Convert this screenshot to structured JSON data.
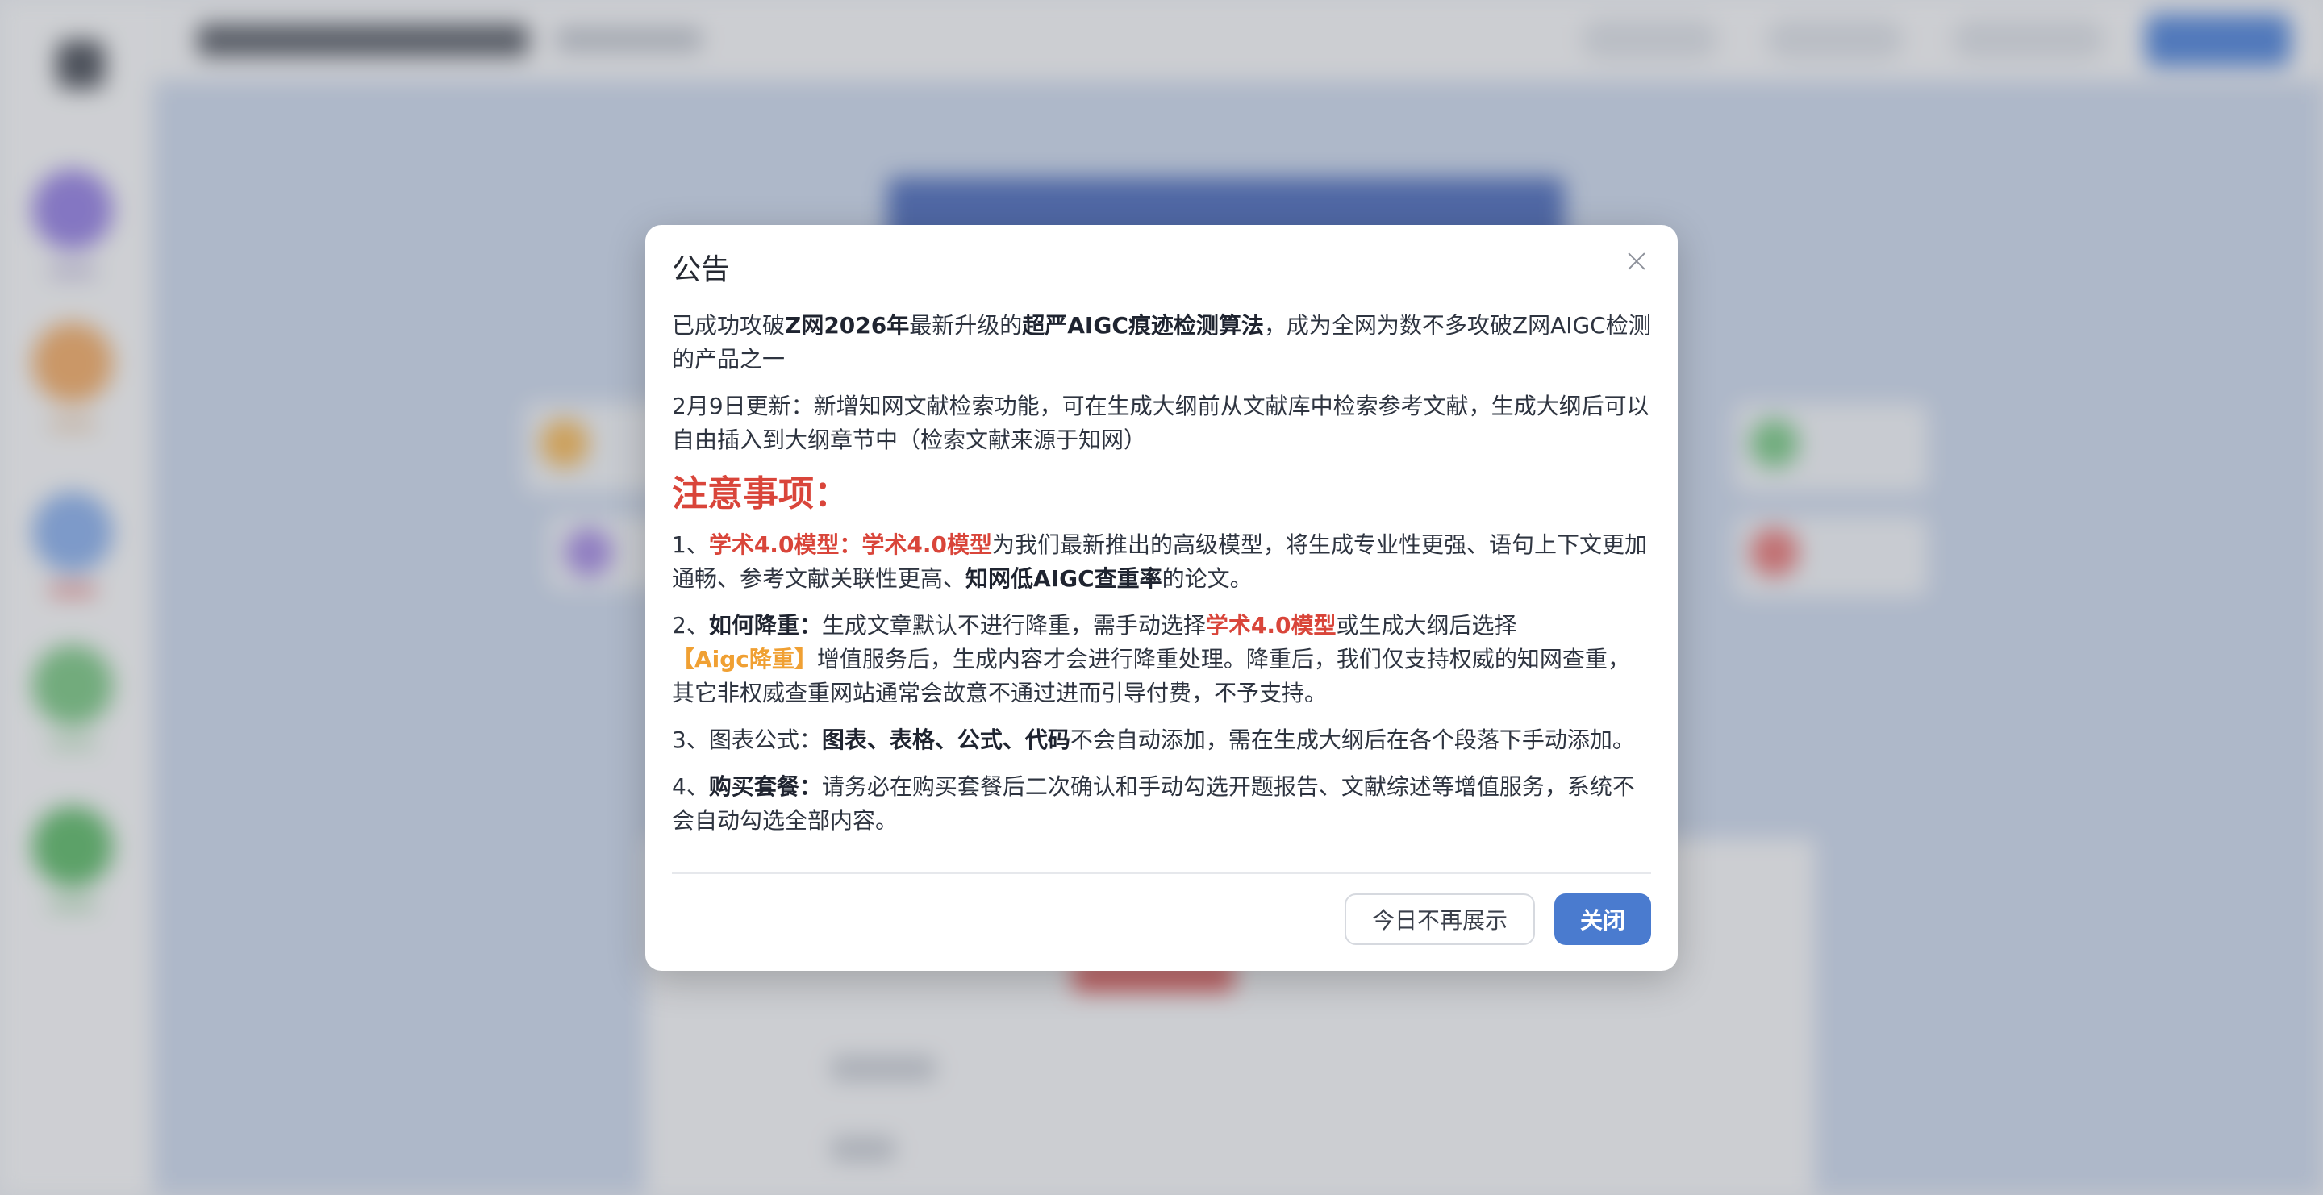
{
  "dialog": {
    "title": "公告",
    "intro": {
      "p1": "已成功攻破",
      "b1": "Z网2026年",
      "p2": "最新升级的",
      "b2": "超严AIGC痕迹检测算法",
      "p3": "，成为全网为数不多攻破Z网AIGC检测的产品之一"
    },
    "update": "2月9日更新：新增知网文献检索功能，可在生成大纲前从文献库中检索参考文献，生成大纲后可以自由插入到大纲章节中（检索文献来源于知网）",
    "notice_heading": "注意事项：",
    "item1": {
      "prefix": "1、",
      "red": "学术4.0模型：学术4.0模型",
      "p1": "为我们最新推出的高级模型，将生成专业性更强、语句上下文更加通畅、参考文献关联性更高、",
      "b1": "知网低AIGC查重率",
      "p2": "的论文。"
    },
    "item2": {
      "prefix": "2、",
      "b1": "如何降重：",
      "p1": "生成文章默认不进行降重，需手动选择",
      "red": "学术4.0模型",
      "p2": "或生成大纲后选择",
      "orange": "【Aigc降重】",
      "p3": "增值服务后，生成内容才会进行降重处理。降重后，我们仅支持权威的知网查重，其它非权威查重网站通常会故意不通过进而引导付费，不予支持。"
    },
    "item3": {
      "prefix": "3、图表公式：",
      "b1": "图表、表格、公式、代码",
      "p1": "不会自动添加，需在生成大纲后在各个段落下手动添加。"
    },
    "item4": {
      "prefix": "4、",
      "b1": "购买套餐：",
      "p1": "请务必在购买套餐后二次确认和手动勾选开题报告、文献综述等增值服务，系统不会自动勾选全部内容。"
    },
    "buttons": {
      "dismiss_today": "今日不再展示",
      "close": "关闭"
    }
  }
}
